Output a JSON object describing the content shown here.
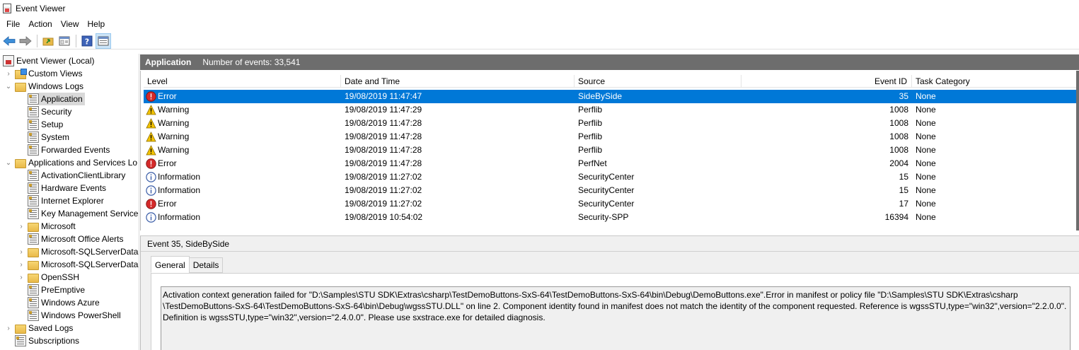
{
  "window": {
    "title": "Event Viewer"
  },
  "menu": [
    "File",
    "Action",
    "View",
    "Help"
  ],
  "toolbar": {
    "icons": [
      "back-arrow-icon",
      "forward-arrow-icon",
      "open-folder-icon",
      "properties-icon",
      "help-icon",
      "show-pane-icon"
    ]
  },
  "tree": {
    "items": [
      {
        "label": "Event Viewer (Local)",
        "icon": "root",
        "indent": 0,
        "chevron": ""
      },
      {
        "label": "Custom Views",
        "icon": "custom",
        "indent": 1,
        "chevron": "›"
      },
      {
        "label": "Windows Logs",
        "icon": "folder",
        "indent": 1,
        "chevron": "⌄"
      },
      {
        "label": "Application",
        "icon": "log",
        "indent": 2,
        "chevron": "",
        "selected": true
      },
      {
        "label": "Security",
        "icon": "log",
        "indent": 2,
        "chevron": ""
      },
      {
        "label": "Setup",
        "icon": "log",
        "indent": 2,
        "chevron": ""
      },
      {
        "label": "System",
        "icon": "log",
        "indent": 2,
        "chevron": ""
      },
      {
        "label": "Forwarded Events",
        "icon": "log",
        "indent": 2,
        "chevron": ""
      },
      {
        "label": "Applications and Services Lo",
        "icon": "folder",
        "indent": 1,
        "chevron": "⌄"
      },
      {
        "label": "ActivationClientLibrary",
        "icon": "log",
        "indent": 2,
        "chevron": ""
      },
      {
        "label": "Hardware Events",
        "icon": "log",
        "indent": 2,
        "chevron": ""
      },
      {
        "label": "Internet Explorer",
        "icon": "log",
        "indent": 2,
        "chevron": ""
      },
      {
        "label": "Key Management Service",
        "icon": "log",
        "indent": 2,
        "chevron": ""
      },
      {
        "label": "Microsoft",
        "icon": "folder",
        "indent": 2,
        "chevron": "›"
      },
      {
        "label": "Microsoft Office Alerts",
        "icon": "log",
        "indent": 2,
        "chevron": ""
      },
      {
        "label": "Microsoft-SQLServerData",
        "icon": "folder",
        "indent": 2,
        "chevron": "›"
      },
      {
        "label": "Microsoft-SQLServerData",
        "icon": "folder",
        "indent": 2,
        "chevron": "›"
      },
      {
        "label": "OpenSSH",
        "icon": "folder",
        "indent": 2,
        "chevron": "›"
      },
      {
        "label": "PreEmptive",
        "icon": "log",
        "indent": 2,
        "chevron": ""
      },
      {
        "label": "Windows Azure",
        "icon": "log",
        "indent": 2,
        "chevron": ""
      },
      {
        "label": "Windows PowerShell",
        "icon": "log",
        "indent": 2,
        "chevron": ""
      },
      {
        "label": "Saved Logs",
        "icon": "folder",
        "indent": 1,
        "chevron": "›"
      },
      {
        "label": "Subscriptions",
        "icon": "log",
        "indent": 1,
        "chevron": ""
      }
    ]
  },
  "panel": {
    "title": "Application",
    "count": "Number of events: 33,541"
  },
  "events": {
    "columns": [
      "Level",
      "Date and Time",
      "Source",
      "Event ID",
      "Task Category"
    ],
    "rows": [
      {
        "level": "Error",
        "datetime": "19/08/2019 11:47:47",
        "source": "SideBySide",
        "event_id": "35",
        "category": "None",
        "selected": true
      },
      {
        "level": "Warning",
        "datetime": "19/08/2019 11:47:29",
        "source": "Perflib",
        "event_id": "1008",
        "category": "None"
      },
      {
        "level": "Warning",
        "datetime": "19/08/2019 11:47:28",
        "source": "Perflib",
        "event_id": "1008",
        "category": "None"
      },
      {
        "level": "Warning",
        "datetime": "19/08/2019 11:47:28",
        "source": "Perflib",
        "event_id": "1008",
        "category": "None"
      },
      {
        "level": "Warning",
        "datetime": "19/08/2019 11:47:28",
        "source": "Perflib",
        "event_id": "1008",
        "category": "None"
      },
      {
        "level": "Error",
        "datetime": "19/08/2019 11:47:28",
        "source": "PerfNet",
        "event_id": "2004",
        "category": "None"
      },
      {
        "level": "Information",
        "datetime": "19/08/2019 11:27:02",
        "source": "SecurityCenter",
        "event_id": "15",
        "category": "None"
      },
      {
        "level": "Information",
        "datetime": "19/08/2019 11:27:02",
        "source": "SecurityCenter",
        "event_id": "15",
        "category": "None"
      },
      {
        "level": "Error",
        "datetime": "19/08/2019 11:27:02",
        "source": "SecurityCenter",
        "event_id": "17",
        "category": "None"
      },
      {
        "level": "Information",
        "datetime": "19/08/2019 10:54:02",
        "source": "Security-SPP",
        "event_id": "16394",
        "category": "None"
      }
    ]
  },
  "detail": {
    "title": "Event 35, SideBySide",
    "tabs": [
      "General",
      "Details"
    ],
    "description_lines": [
      "Activation context generation failed for \"D:\\Samples\\STU SDK\\Extras\\csharp\\TestDemoButtons-SxS-64\\TestDemoButtons-SxS-64\\bin\\Debug\\DemoButtons.exe\".Error in manifest or policy file \"D:\\Samples\\STU SDK\\Extras\\csharp",
      "\\TestDemoButtons-SxS-64\\TestDemoButtons-SxS-64\\bin\\Debug\\wgssSTU.DLL\" on line 2. Component identity found in manifest does not match the identity of the component requested. Reference is wgssSTU,type=\"win32\",version=\"2.2.0.0\".",
      "Definition is wgssSTU,type=\"win32\",version=\"2.4.0.0\". Please use sxstrace.exe for detailed diagnosis."
    ]
  },
  "colors": {
    "selection": "#0078d7",
    "panel_header": "#6d6d6d",
    "error": "#d42a2a",
    "warning": "#f2c200",
    "info": "#3a5da8"
  }
}
